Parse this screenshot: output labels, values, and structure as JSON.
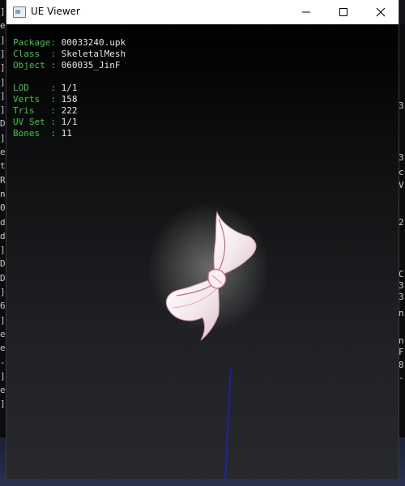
{
  "window": {
    "title": "UE Viewer",
    "controls": {
      "minimize": "minimize",
      "maximize": "maximize",
      "close": "close"
    }
  },
  "info": {
    "package_label": "Package",
    "package_value": "00033240.upk",
    "class_label": "Class",
    "class_value": "SkeletalMesh",
    "object_label": "Object",
    "object_value": "060035_JinF",
    "lod_label": "LOD",
    "lod_value": "1/1",
    "verts_label": "Verts",
    "verts_value": "158",
    "tris_label": "Tris",
    "tris_value": "222",
    "uvset_label": "UV Set",
    "uvset_value": "1/1",
    "bones_label": "Bones",
    "bones_value": "11"
  },
  "background_left": [
    "]",
    "e",
    "]",
    "]",
    "]",
    "]",
    "]",
    "]",
    "D",
    "]",
    "e",
    "t",
    "R",
    "n",
    "0",
    "d",
    "d",
    "]",
    "D",
    "D",
    "]",
    "6",
    "]",
    "e",
    "e",
    "-",
    "]",
    "e",
    "]"
  ],
  "background_right": [
    "3",
    "3",
    "c",
    "V",
    "2",
    "C",
    "3",
    "3",
    "n",
    "n",
    "F",
    "8",
    "-"
  ],
  "colors": {
    "label": "#39c93a",
    "value": "#e6e6e6",
    "axis": "#1a1aff",
    "titlebar": "#ffffff"
  },
  "icons": {
    "app": "ue-viewer-app-icon",
    "minimize": "minimize-icon",
    "maximize": "maximize-icon",
    "close": "close-icon"
  }
}
